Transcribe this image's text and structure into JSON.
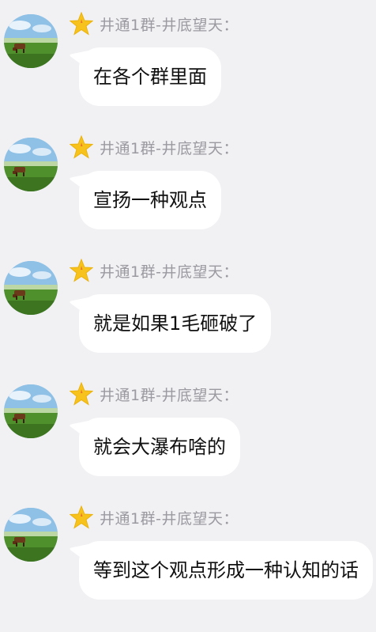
{
  "sender": {
    "name": "井通1群-井底望天：",
    "badge_icon": "star-icon",
    "avatar_icon": "cow-on-grassland-avatar"
  },
  "messages": [
    {
      "text": "在各个群里面"
    },
    {
      "text": "宣扬一种观点"
    },
    {
      "text": "就是如果1毛砸破了"
    },
    {
      "text": "就会大瀑布啥的"
    },
    {
      "text": "等到这个观点形成一种认知的话"
    }
  ],
  "colors": {
    "background": "#f1f1f4",
    "bubble": "#ffffff",
    "sender_name": "#9a9aa0",
    "star": "#f7c21b"
  }
}
